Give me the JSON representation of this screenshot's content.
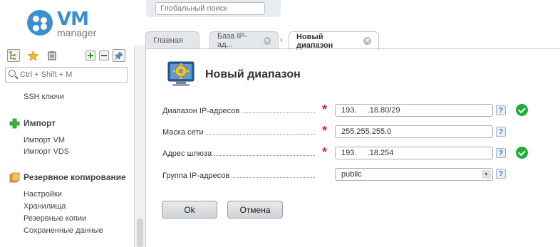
{
  "logo": {
    "brand": "VM",
    "product": "manager"
  },
  "global_search": {
    "placeholder": "Глобальный поиск"
  },
  "sidebar": {
    "search_placeholder": "Ctrl + Shift + M",
    "items_top": [
      "SSH ключи"
    ],
    "groups": [
      {
        "title": "Импорт",
        "items": [
          "Импорт VM",
          "Импорт VDS"
        ]
      },
      {
        "title": "Резервное копирование",
        "items": [
          "Настройки",
          "Хранилища",
          "Резервные копии",
          "Сохраненные данные"
        ]
      }
    ]
  },
  "tabs": [
    {
      "label": "Главная",
      "closable": false,
      "active": false
    },
    {
      "label": "База IP-ад...",
      "closable": true,
      "active": false
    },
    {
      "label": "Новый диапазон",
      "closable": true,
      "active": true
    }
  ],
  "form": {
    "title": "Новый диапазон",
    "fields": [
      {
        "label": "Диапазон IP-адресов",
        "value": "193.     .18.80/29",
        "required": true,
        "valid": true,
        "type": "text"
      },
      {
        "label": "Маска сети",
        "value": "255.255.255.0",
        "required": true,
        "valid": false,
        "type": "text"
      },
      {
        "label": "Адрес шлюза",
        "value": "193.     .18.254",
        "required": true,
        "valid": true,
        "type": "text"
      },
      {
        "label": "Группа IP-адресов",
        "value": "public",
        "required": false,
        "valid": false,
        "type": "select"
      }
    ],
    "help_glyph": "?",
    "required_glyph": "*",
    "ok_label": "Ok",
    "cancel_label": "Отмена"
  },
  "colors": {
    "accent": "#3a8fd0",
    "required": "#d62b2b",
    "valid": "#1fae3c"
  }
}
